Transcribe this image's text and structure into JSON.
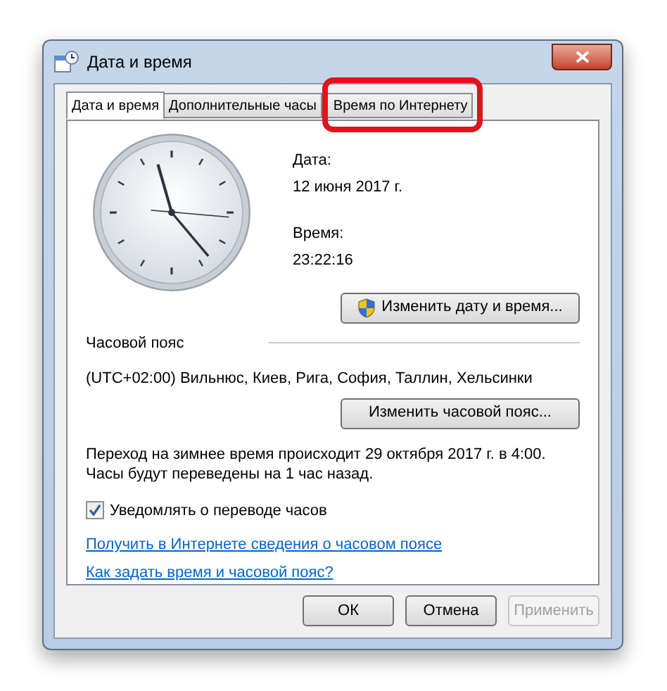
{
  "window": {
    "title": "Дата и время"
  },
  "tabs": [
    {
      "label": "Дата и время",
      "selected": true,
      "highlighted": false
    },
    {
      "label": "Дополнительные часы",
      "selected": false,
      "highlighted": false
    },
    {
      "label": "Время по Интернету",
      "selected": false,
      "highlighted": true
    }
  ],
  "date": {
    "label": "Дата:",
    "value": "12 июня 2017 г."
  },
  "time": {
    "label": "Время:",
    "value": "23:22:16"
  },
  "change_datetime_button": "Изменить дату и время...",
  "timezone": {
    "heading": "Часовой пояс",
    "value": "(UTC+02:00) Вильнюс, Киев, Рига, София, Таллин, Хельсинки",
    "button": "Изменить часовой пояс..."
  },
  "dst_notice": "Переход на зимнее время происходит 29 октября 2017 г. в 4:00. Часы будут переведены на 1 час назад.",
  "notify_checkbox": {
    "label": "Уведомлять о переводе часов",
    "checked": true
  },
  "links": [
    "Получить в Интернете сведения о часовом поясе",
    "Как задать время и часовой пояс?"
  ],
  "buttons": [
    {
      "label": "ОК",
      "disabled": false
    },
    {
      "label": "Отмена",
      "disabled": false
    },
    {
      "label": "Применить",
      "disabled": true
    }
  ]
}
